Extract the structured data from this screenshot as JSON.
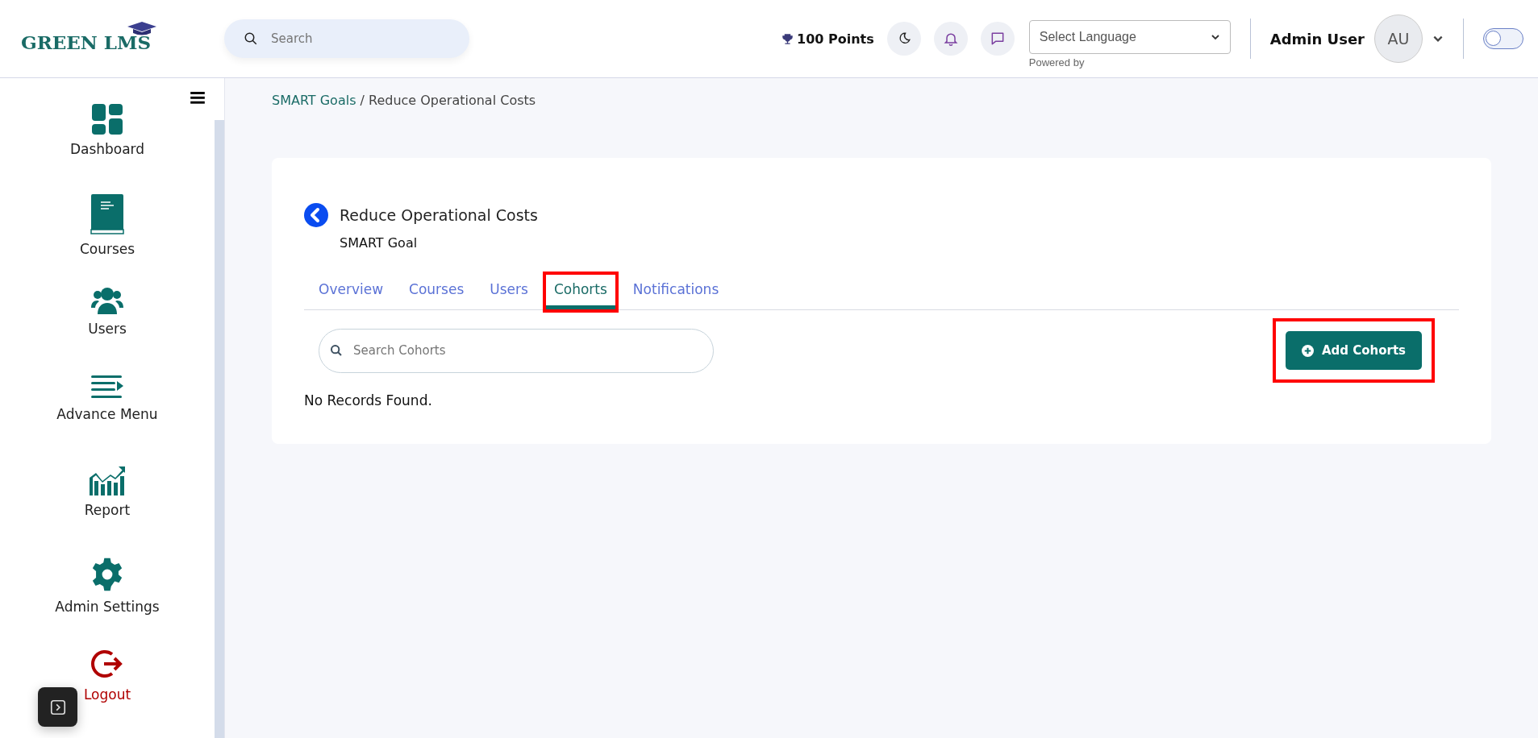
{
  "header": {
    "logo": "GREEN LMS",
    "search": {
      "placeholder": "Search"
    },
    "points": "100 Points",
    "language": {
      "value": "Select Language",
      "note": "Powered by"
    },
    "user": {
      "name": "Admin User",
      "initials": "AU"
    },
    "toggle": {
      "on": false
    }
  },
  "sidebar": {
    "items": [
      {
        "label": "Dashboard",
        "kind": "normal"
      },
      {
        "label": "Courses",
        "kind": "normal"
      },
      {
        "label": "Users",
        "kind": "normal"
      },
      {
        "label": "Advance Menu",
        "kind": "normal"
      },
      {
        "label": "Report",
        "kind": "normal"
      },
      {
        "label": "Admin Settings",
        "kind": "normal"
      },
      {
        "label": "Logout",
        "kind": "danger"
      }
    ]
  },
  "breadcrumb": {
    "parent": "SMART Goals",
    "current": "/ Reduce Operational Costs"
  },
  "page": {
    "title": "Reduce Operational Costs",
    "subtitle": "SMART Goal",
    "tabs": [
      {
        "label": "Overview",
        "selected": false,
        "highlighted": false
      },
      {
        "label": "Courses",
        "selected": false,
        "highlighted": false
      },
      {
        "label": "Users",
        "selected": false,
        "highlighted": false
      },
      {
        "label": "Cohorts",
        "selected": true,
        "highlighted": true
      },
      {
        "label": "Notifications",
        "selected": false,
        "highlighted": false
      }
    ],
    "search": {
      "placeholder": "Search Cohorts"
    },
    "add_button": {
      "label": "Add Cohorts",
      "highlighted": true
    },
    "empty": "No Records Found."
  }
}
